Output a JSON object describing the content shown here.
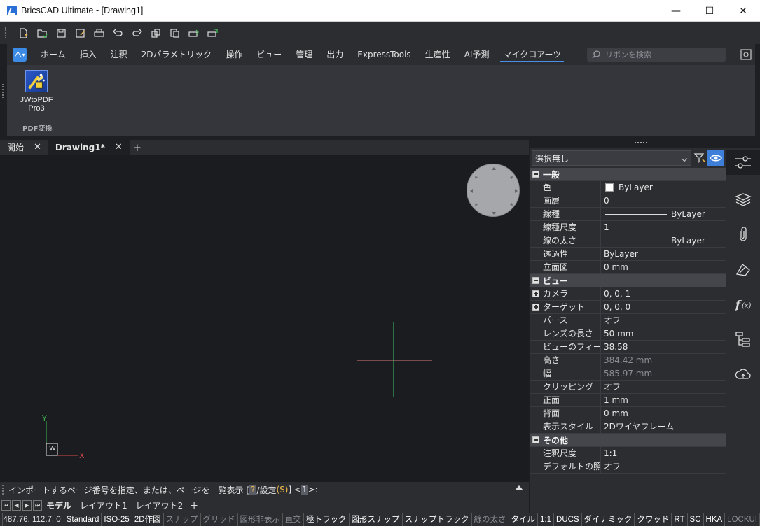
{
  "window": {
    "title": "BricsCAD Ultimate - [Drawing1]",
    "minimize": "—",
    "maximize": "☐",
    "close": "✕"
  },
  "quick_access": {
    "buttons": [
      "new-icon",
      "open-icon",
      "save-icon",
      "save-as-icon",
      "print-icon",
      "undo-icon",
      "redo-icon",
      "copy-clip-icon",
      "paste-icon",
      "plot-icon",
      "publish-icon"
    ]
  },
  "ribbon": {
    "tabs": [
      "ホーム",
      "挿入",
      "注釈",
      "2Dパラメトリック",
      "操作",
      "ビュー",
      "管理",
      "出力",
      "ExpressTools",
      "生産性",
      "AI予測",
      "マイクロアーツ"
    ],
    "active_tab": "マイクロアーツ",
    "search_placeholder": "リボンを検索",
    "panel": {
      "button_label_line1": "JWtoPDF",
      "button_label_line2": "Pro3",
      "title": "PDF変換"
    }
  },
  "doc_tabs": {
    "start": "開始",
    "drawing": "Drawing1*",
    "add": "+"
  },
  "ucs": {
    "x_label": "X",
    "y_label": "Y",
    "w_label": "W"
  },
  "command_line": {
    "prompt_text": "インポートするページ番号を指定、または、ページを一覧表示 [",
    "key": "?",
    "mid_text": "/設定 ",
    "option": "(S)",
    "close_text": "] <",
    "default": "1",
    "end_text": ">:"
  },
  "layout_tabs": [
    "モデル",
    "レイアウト1",
    "レイアウト2"
  ],
  "layout_add": "+",
  "status_bar": {
    "coords": "487.76, 112.7, 0",
    "items": [
      {
        "label": "Standard",
        "state": "on"
      },
      {
        "label": "ISO-25",
        "state": "on"
      },
      {
        "label": "2D作図",
        "state": "on"
      },
      {
        "label": "スナップ",
        "state": "off"
      },
      {
        "label": "グリッド",
        "state": "off"
      },
      {
        "label": "図形非表示",
        "state": "off"
      },
      {
        "label": "直交",
        "state": "off"
      },
      {
        "label": "極トラック",
        "state": "on"
      },
      {
        "label": "図形スナップ",
        "state": "on"
      },
      {
        "label": "スナップトラック",
        "state": "on"
      },
      {
        "label": "線の太さ",
        "state": "off"
      },
      {
        "label": "タイル",
        "state": "on"
      },
      {
        "label": "1:1",
        "state": "on"
      },
      {
        "label": "DUCS",
        "state": "on"
      },
      {
        "label": "ダイナミック",
        "state": "on"
      },
      {
        "label": "クワッド",
        "state": "on"
      },
      {
        "label": "RT",
        "state": "on"
      },
      {
        "label": "SC",
        "state": "on"
      },
      {
        "label": "HKA",
        "state": "on"
      },
      {
        "label": "LOCKUI",
        "state": "off"
      }
    ]
  },
  "properties": {
    "selection": "選択無し",
    "sections": [
      {
        "title": "一般",
        "rows": [
          {
            "name": "色",
            "value": "ByLayer",
            "kind": "color"
          },
          {
            "name": "画層",
            "value": "0"
          },
          {
            "name": "線種",
            "value": "ByLayer",
            "kind": "line"
          },
          {
            "name": "線種尺度",
            "value": "1"
          },
          {
            "name": "線の太さ",
            "value": "ByLayer",
            "kind": "line"
          },
          {
            "name": "透過性",
            "value": "ByLayer"
          },
          {
            "name": "立面図",
            "value": "0 mm"
          }
        ]
      },
      {
        "title": "ビュー",
        "rows": [
          {
            "name": "カメラ",
            "value": "0, 0, 1",
            "expand": true
          },
          {
            "name": "ターゲット",
            "value": "0, 0, 0",
            "expand": true
          },
          {
            "name": "パース",
            "value": "オフ"
          },
          {
            "name": "レンズの長さ",
            "value": "50 mm"
          },
          {
            "name": "ビューのフィールド",
            "value": "38.58"
          },
          {
            "name": "高さ",
            "value": "384.42 mm",
            "dim": true
          },
          {
            "name": "幅",
            "value": "585.97 mm",
            "dim": true
          },
          {
            "name": "クリッピング",
            "value": "オフ"
          },
          {
            "name": "正面",
            "value": "1 mm"
          },
          {
            "name": "背面",
            "value": "0 mm"
          },
          {
            "name": "表示スタイル",
            "value": "2Dワイヤフレーム"
          }
        ]
      },
      {
        "title": "その他",
        "rows": [
          {
            "name": "注釈尺度",
            "value": "1:1"
          },
          {
            "name": "デフォルトの照明",
            "value": "オフ"
          }
        ]
      }
    ]
  },
  "side_panel": [
    "properties-sliders-icon",
    "layers-icon",
    "attachments-clip-icon",
    "drawing-explorer-icon",
    "formula-fx-icon",
    "structure-tree-icon",
    "cloud-icon"
  ],
  "colors": {
    "accent": "#3d7fd9",
    "crosshair_x": "#d9797e",
    "crosshair_y": "#39c46a",
    "ucs_x": "#d64a4a",
    "ucs_y": "#3fbf52"
  }
}
